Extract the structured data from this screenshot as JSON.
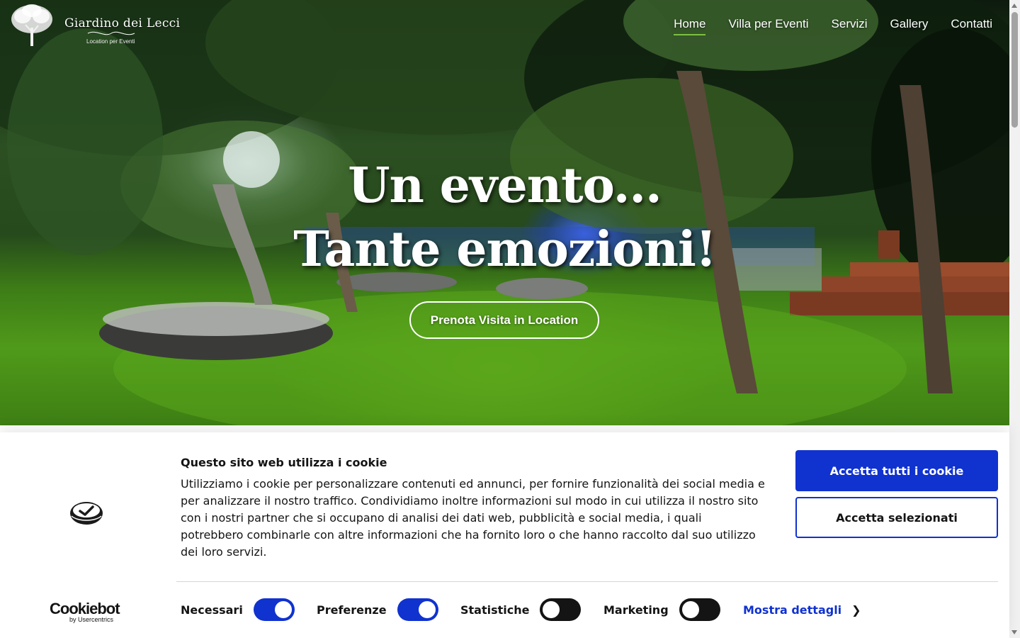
{
  "header": {
    "logo_title": "Giardino dei Lecci",
    "logo_subtitle": "Location per Eventi",
    "nav": [
      {
        "label": "Home",
        "active": true
      },
      {
        "label": "Villa per Eventi",
        "active": false
      },
      {
        "label": "Servizi",
        "active": false
      },
      {
        "label": "Gallery",
        "active": false
      },
      {
        "label": "Contatti",
        "active": false
      }
    ]
  },
  "hero": {
    "title_line1": "Un evento...",
    "title_line2": "Tante emozioni!",
    "cta_label": "Prenota Visita in Location"
  },
  "cookie_banner": {
    "title": "Questo sito web utilizza i cookie",
    "body": "Utilizziamo i cookie per personalizzare contenuti ed annunci, per fornire funzionalità dei social media e per analizzare il nostro traffico. Condividiamo inoltre informazioni sul modo in cui utilizza il nostro sito con i nostri partner che si occupano di analisi dei dati web, pubblicità e social media, i quali potrebbero combinarle con altre informazioni che ha fornito loro o che hanno raccolto dal suo utilizzo dei loro servizi.",
    "accept_all_label": "Accetta tutti i cookie",
    "accept_selected_label": "Accetta selezionati",
    "brand_name": "Cookiebot",
    "brand_by": "by Usercentrics",
    "toggles": [
      {
        "label": "Necessari",
        "on": true
      },
      {
        "label": "Preferenze",
        "on": true
      },
      {
        "label": "Statistiche",
        "on": false
      },
      {
        "label": "Marketing",
        "on": false
      }
    ],
    "details_label": "Mostra dettagli",
    "accent_color": "#1032cf"
  }
}
